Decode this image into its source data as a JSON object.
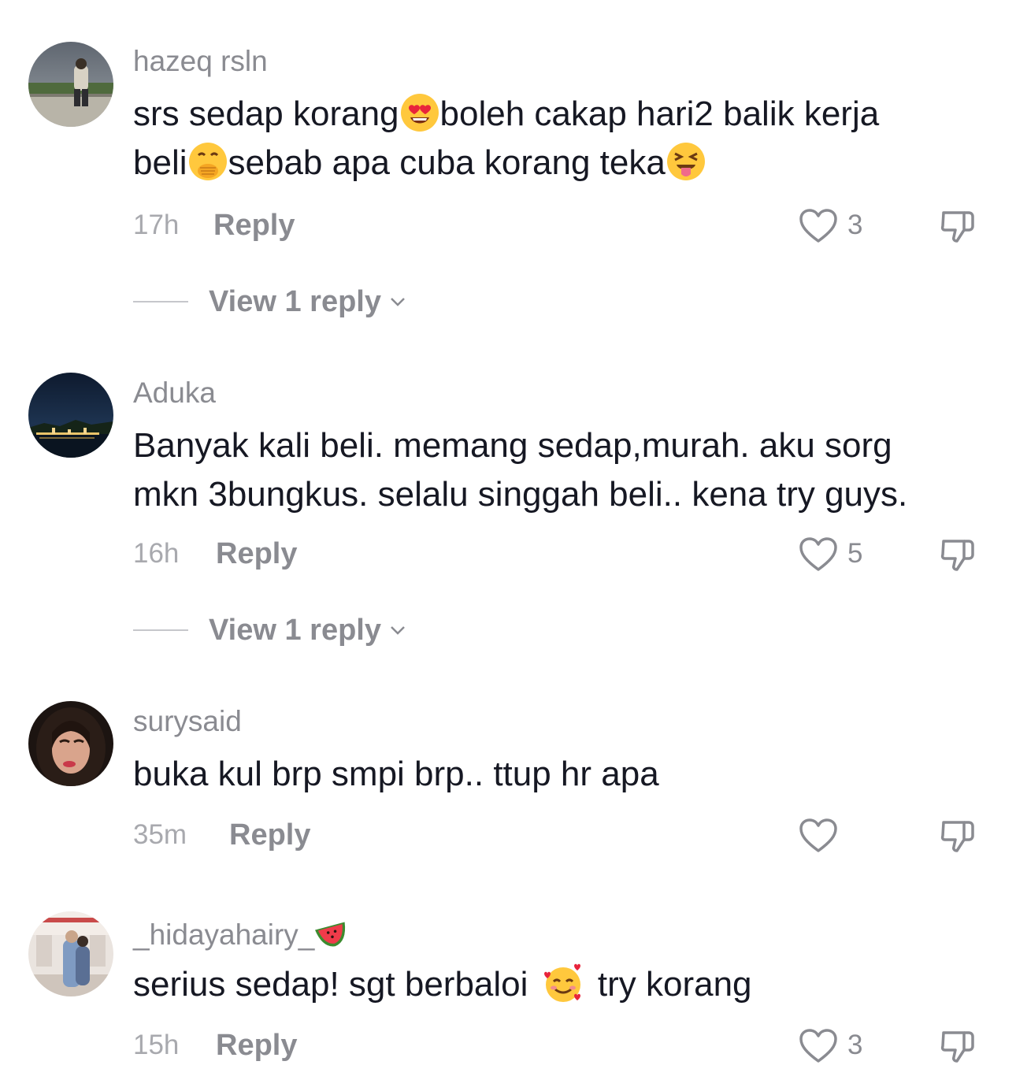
{
  "comments": [
    {
      "username": "hazeq rsln",
      "line1_a": "srs sedap korang",
      "line1_b": "boleh cakap hari2 balik kerja",
      "line2_a": "beli",
      "line2_b": "sebab apa cuba korang teka",
      "emojis": [
        "heart-eyes-emoji",
        "hand-over-mouth-emoji",
        "squinting-tongue-emoji"
      ],
      "time": "17h",
      "reply_label": "Reply",
      "likes": "3",
      "view_replies": "View 1 reply"
    },
    {
      "username": "Aduka",
      "line1": "Banyak kali beli. memang sedap,murah. aku sorg",
      "line2": "mkn 3bungkus. selalu singgah beli.. kena try guys.",
      "time": "16h",
      "reply_label": "Reply",
      "likes": "5",
      "view_replies": "View 1 reply"
    },
    {
      "username": "surysaid",
      "line1": "buka kul brp smpi brp.. ttup hr apa",
      "time": "35m",
      "reply_label": "Reply",
      "likes": ""
    },
    {
      "username": "_hidayahairy_",
      "username_emoji": "watermelon-emoji",
      "line1_a": "serius sedap! sgt berbaloi",
      "line1_b": "try korang",
      "emojis": [
        "smiling-face-with-hearts-emoji"
      ],
      "time": "15h",
      "reply_label": "Reply",
      "likes": "3"
    }
  ],
  "colors": {
    "text": "#161823",
    "username": "#8a8b91",
    "meta": "#a8a9ae",
    "icon_stroke": "#8a8b91"
  }
}
